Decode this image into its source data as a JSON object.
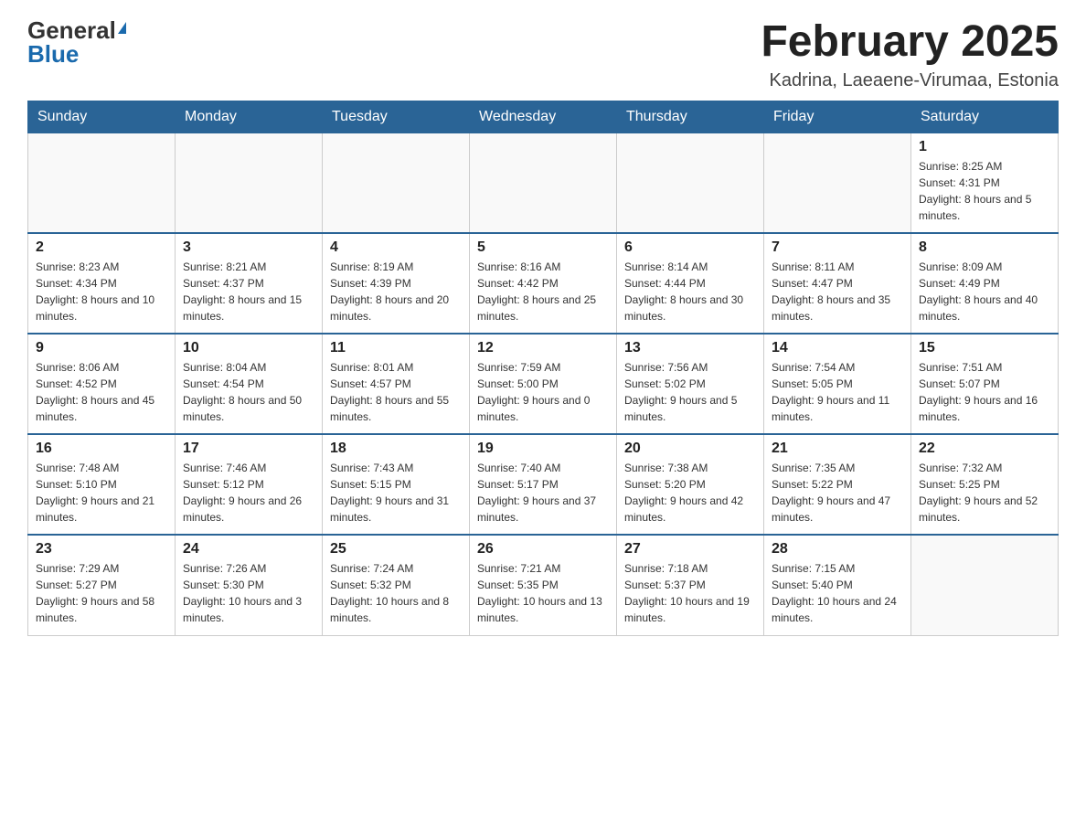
{
  "logo": {
    "general": "General",
    "blue": "Blue"
  },
  "title": "February 2025",
  "subtitle": "Kadrina, Laeaene-Virumaa, Estonia",
  "days_of_week": [
    "Sunday",
    "Monday",
    "Tuesday",
    "Wednesday",
    "Thursday",
    "Friday",
    "Saturday"
  ],
  "weeks": [
    [
      {
        "day": "",
        "sunrise": "",
        "sunset": "",
        "daylight": ""
      },
      {
        "day": "",
        "sunrise": "",
        "sunset": "",
        "daylight": ""
      },
      {
        "day": "",
        "sunrise": "",
        "sunset": "",
        "daylight": ""
      },
      {
        "day": "",
        "sunrise": "",
        "sunset": "",
        "daylight": ""
      },
      {
        "day": "",
        "sunrise": "",
        "sunset": "",
        "daylight": ""
      },
      {
        "day": "",
        "sunrise": "",
        "sunset": "",
        "daylight": ""
      },
      {
        "day": "1",
        "sunrise": "Sunrise: 8:25 AM",
        "sunset": "Sunset: 4:31 PM",
        "daylight": "Daylight: 8 hours and 5 minutes."
      }
    ],
    [
      {
        "day": "2",
        "sunrise": "Sunrise: 8:23 AM",
        "sunset": "Sunset: 4:34 PM",
        "daylight": "Daylight: 8 hours and 10 minutes."
      },
      {
        "day": "3",
        "sunrise": "Sunrise: 8:21 AM",
        "sunset": "Sunset: 4:37 PM",
        "daylight": "Daylight: 8 hours and 15 minutes."
      },
      {
        "day": "4",
        "sunrise": "Sunrise: 8:19 AM",
        "sunset": "Sunset: 4:39 PM",
        "daylight": "Daylight: 8 hours and 20 minutes."
      },
      {
        "day": "5",
        "sunrise": "Sunrise: 8:16 AM",
        "sunset": "Sunset: 4:42 PM",
        "daylight": "Daylight: 8 hours and 25 minutes."
      },
      {
        "day": "6",
        "sunrise": "Sunrise: 8:14 AM",
        "sunset": "Sunset: 4:44 PM",
        "daylight": "Daylight: 8 hours and 30 minutes."
      },
      {
        "day": "7",
        "sunrise": "Sunrise: 8:11 AM",
        "sunset": "Sunset: 4:47 PM",
        "daylight": "Daylight: 8 hours and 35 minutes."
      },
      {
        "day": "8",
        "sunrise": "Sunrise: 8:09 AM",
        "sunset": "Sunset: 4:49 PM",
        "daylight": "Daylight: 8 hours and 40 minutes."
      }
    ],
    [
      {
        "day": "9",
        "sunrise": "Sunrise: 8:06 AM",
        "sunset": "Sunset: 4:52 PM",
        "daylight": "Daylight: 8 hours and 45 minutes."
      },
      {
        "day": "10",
        "sunrise": "Sunrise: 8:04 AM",
        "sunset": "Sunset: 4:54 PM",
        "daylight": "Daylight: 8 hours and 50 minutes."
      },
      {
        "day": "11",
        "sunrise": "Sunrise: 8:01 AM",
        "sunset": "Sunset: 4:57 PM",
        "daylight": "Daylight: 8 hours and 55 minutes."
      },
      {
        "day": "12",
        "sunrise": "Sunrise: 7:59 AM",
        "sunset": "Sunset: 5:00 PM",
        "daylight": "Daylight: 9 hours and 0 minutes."
      },
      {
        "day": "13",
        "sunrise": "Sunrise: 7:56 AM",
        "sunset": "Sunset: 5:02 PM",
        "daylight": "Daylight: 9 hours and 5 minutes."
      },
      {
        "day": "14",
        "sunrise": "Sunrise: 7:54 AM",
        "sunset": "Sunset: 5:05 PM",
        "daylight": "Daylight: 9 hours and 11 minutes."
      },
      {
        "day": "15",
        "sunrise": "Sunrise: 7:51 AM",
        "sunset": "Sunset: 5:07 PM",
        "daylight": "Daylight: 9 hours and 16 minutes."
      }
    ],
    [
      {
        "day": "16",
        "sunrise": "Sunrise: 7:48 AM",
        "sunset": "Sunset: 5:10 PM",
        "daylight": "Daylight: 9 hours and 21 minutes."
      },
      {
        "day": "17",
        "sunrise": "Sunrise: 7:46 AM",
        "sunset": "Sunset: 5:12 PM",
        "daylight": "Daylight: 9 hours and 26 minutes."
      },
      {
        "day": "18",
        "sunrise": "Sunrise: 7:43 AM",
        "sunset": "Sunset: 5:15 PM",
        "daylight": "Daylight: 9 hours and 31 minutes."
      },
      {
        "day": "19",
        "sunrise": "Sunrise: 7:40 AM",
        "sunset": "Sunset: 5:17 PM",
        "daylight": "Daylight: 9 hours and 37 minutes."
      },
      {
        "day": "20",
        "sunrise": "Sunrise: 7:38 AM",
        "sunset": "Sunset: 5:20 PM",
        "daylight": "Daylight: 9 hours and 42 minutes."
      },
      {
        "day": "21",
        "sunrise": "Sunrise: 7:35 AM",
        "sunset": "Sunset: 5:22 PM",
        "daylight": "Daylight: 9 hours and 47 minutes."
      },
      {
        "day": "22",
        "sunrise": "Sunrise: 7:32 AM",
        "sunset": "Sunset: 5:25 PM",
        "daylight": "Daylight: 9 hours and 52 minutes."
      }
    ],
    [
      {
        "day": "23",
        "sunrise": "Sunrise: 7:29 AM",
        "sunset": "Sunset: 5:27 PM",
        "daylight": "Daylight: 9 hours and 58 minutes."
      },
      {
        "day": "24",
        "sunrise": "Sunrise: 7:26 AM",
        "sunset": "Sunset: 5:30 PM",
        "daylight": "Daylight: 10 hours and 3 minutes."
      },
      {
        "day": "25",
        "sunrise": "Sunrise: 7:24 AM",
        "sunset": "Sunset: 5:32 PM",
        "daylight": "Daylight: 10 hours and 8 minutes."
      },
      {
        "day": "26",
        "sunrise": "Sunrise: 7:21 AM",
        "sunset": "Sunset: 5:35 PM",
        "daylight": "Daylight: 10 hours and 13 minutes."
      },
      {
        "day": "27",
        "sunrise": "Sunrise: 7:18 AM",
        "sunset": "Sunset: 5:37 PM",
        "daylight": "Daylight: 10 hours and 19 minutes."
      },
      {
        "day": "28",
        "sunrise": "Sunrise: 7:15 AM",
        "sunset": "Sunset: 5:40 PM",
        "daylight": "Daylight: 10 hours and 24 minutes."
      },
      {
        "day": "",
        "sunrise": "",
        "sunset": "",
        "daylight": ""
      }
    ]
  ]
}
